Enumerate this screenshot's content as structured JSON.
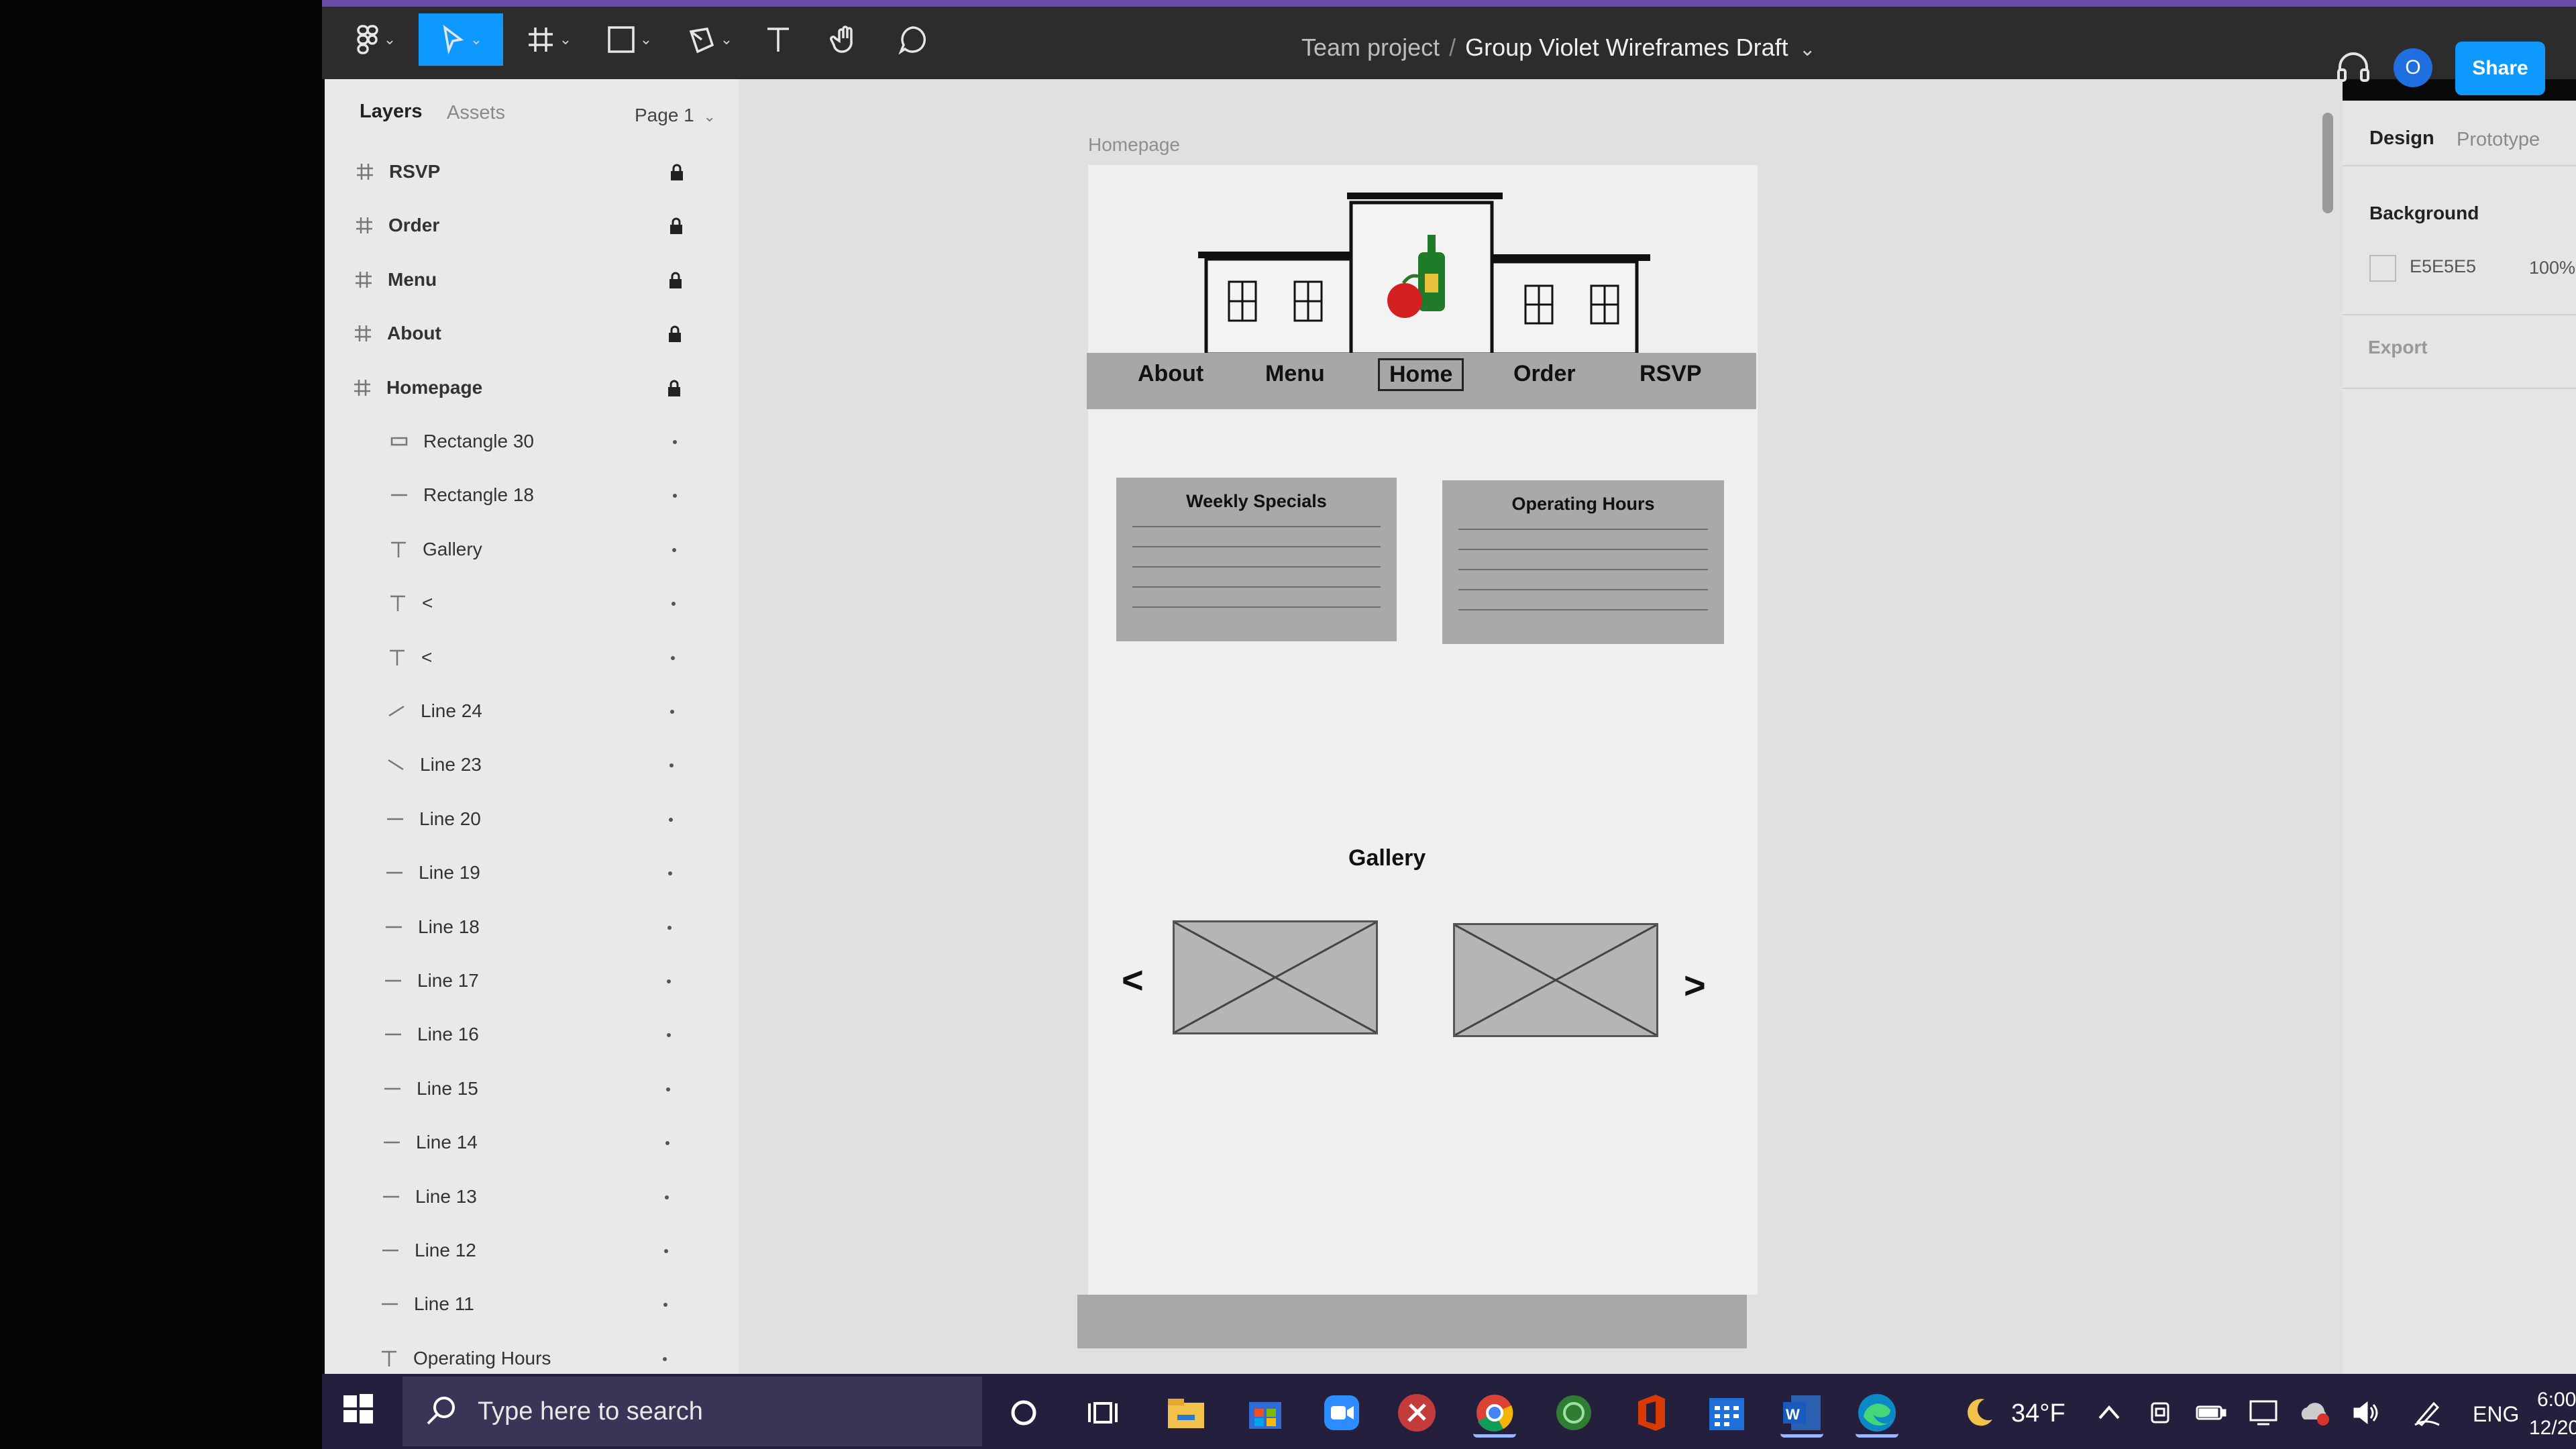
{
  "toolbar": {
    "breadcrumb_team": "Team project",
    "breadcrumb_sep": "/",
    "file_name": "Group Violet Wireframes Draft",
    "share_label": "Share",
    "avatar_initial": "O"
  },
  "left_panel": {
    "tab_layers": "Layers",
    "tab_assets": "Assets",
    "page_selector": "Page 1",
    "layers": [
      {
        "name": "RSVP",
        "type": "frame",
        "locked": true
      },
      {
        "name": "Order",
        "type": "frame",
        "locked": true
      },
      {
        "name": "Menu",
        "type": "frame",
        "locked": true
      },
      {
        "name": "About",
        "type": "frame",
        "locked": true
      },
      {
        "name": "Homepage",
        "type": "frame",
        "locked": true
      },
      {
        "name": "Rectangle 30",
        "type": "rect"
      },
      {
        "name": "Rectangle 18",
        "type": "line"
      },
      {
        "name": "Gallery",
        "type": "text"
      },
      {
        "name": "<",
        "type": "text"
      },
      {
        "name": "<",
        "type": "text"
      },
      {
        "name": "Line 24",
        "type": "diag-up"
      },
      {
        "name": "Line 23",
        "type": "diag-down"
      },
      {
        "name": "Line 20",
        "type": "line"
      },
      {
        "name": "Line 19",
        "type": "line"
      },
      {
        "name": "Line 18",
        "type": "line"
      },
      {
        "name": "Line 17",
        "type": "line"
      },
      {
        "name": "Line 16",
        "type": "line"
      },
      {
        "name": "Line 15",
        "type": "line"
      },
      {
        "name": "Line 14",
        "type": "line"
      },
      {
        "name": "Line 13",
        "type": "line"
      },
      {
        "name": "Line 12",
        "type": "line"
      },
      {
        "name": "Line 11",
        "type": "line"
      },
      {
        "name": "Operating Hours",
        "type": "text"
      }
    ]
  },
  "canvas": {
    "frame_label": "Homepage",
    "nav": [
      "About",
      "Menu",
      "Home",
      "Order",
      "RSVP"
    ],
    "card_specials_title": "Weekly Specials",
    "card_hours_title": "Operating Hours",
    "gallery_title": "Gallery",
    "arrow_prev": "<",
    "arrow_next": ">"
  },
  "right_panel": {
    "tab_design": "Design",
    "tab_prototype": "Prototype",
    "background_label": "Background",
    "bg_hex": "E5E5E5",
    "bg_opacity": "100%",
    "export_label": "Export",
    "bg_color": "#E5E5E5"
  },
  "taskbar": {
    "search_placeholder": "Type here to search",
    "weather": "34°F",
    "lang": "ENG",
    "time": "6:00",
    "date": "12/20/"
  }
}
